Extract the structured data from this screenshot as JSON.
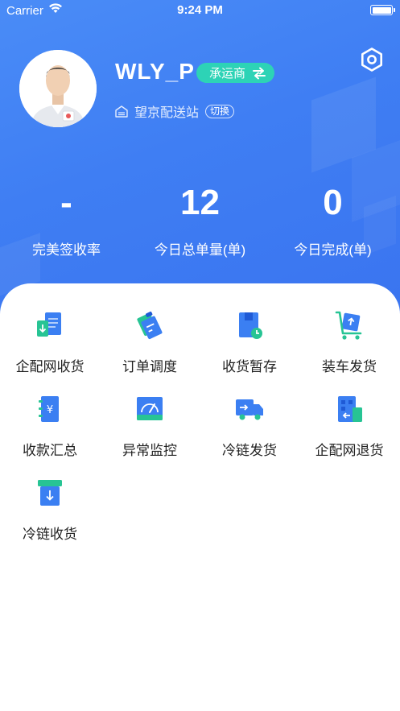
{
  "status_bar": {
    "carrier": "Carrier",
    "time": "9:24 PM"
  },
  "profile": {
    "username": "WLY_P",
    "role": "承运商",
    "station": "望京配送站",
    "switch_label": "切换"
  },
  "stats": [
    {
      "value": "-",
      "label": "完美签收率"
    },
    {
      "value": "12",
      "label": "今日总单量(单)"
    },
    {
      "value": "0",
      "label": "今日完成(单)"
    }
  ],
  "menu": [
    {
      "label": "企配网收货",
      "icon": "enterprise-receive-icon"
    },
    {
      "label": "订单调度",
      "icon": "order-dispatch-icon"
    },
    {
      "label": "收货暂存",
      "icon": "receive-storage-icon"
    },
    {
      "label": "装车发货",
      "icon": "loading-ship-icon"
    },
    {
      "label": "收款汇总",
      "icon": "payment-summary-icon"
    },
    {
      "label": "异常监控",
      "icon": "exception-monitor-icon"
    },
    {
      "label": "冷链发货",
      "icon": "cold-chain-ship-icon"
    },
    {
      "label": "企配网退货",
      "icon": "enterprise-return-icon"
    },
    {
      "label": "冷链收货",
      "icon": "cold-chain-receive-icon"
    }
  ],
  "colors": {
    "header": "#3f7ef3",
    "accent_teal": "#2dd3b6",
    "icon_blue": "#3b7ff2",
    "icon_green": "#27c494"
  }
}
